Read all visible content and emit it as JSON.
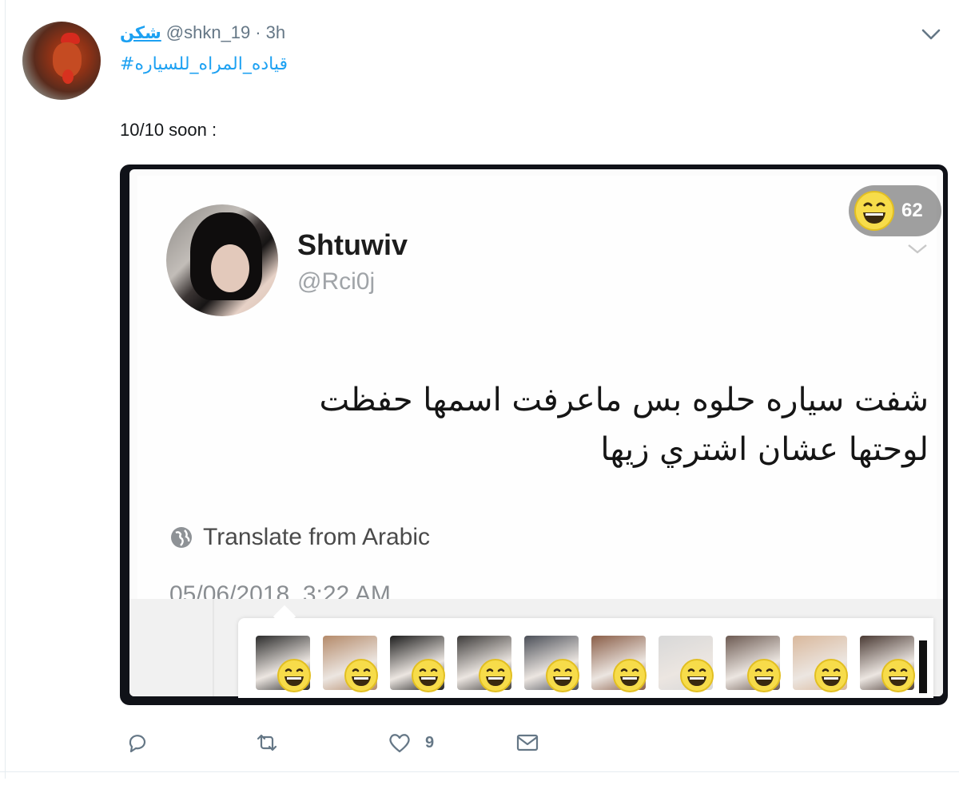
{
  "tweet": {
    "display_name": "شكن",
    "handle": "@shkn_19",
    "separator": "·",
    "time": "3h",
    "hashtag": "#قياده_المراه_للسياره",
    "text": "10/10 soon :"
  },
  "embedded_screenshot": {
    "author_name": "Shtuwiv",
    "author_handle": "@Rci0j",
    "reaction_count": "62",
    "text_line_1": "شفت سياره حلوه بس ماعرفت اسمها حفظت",
    "text_line_2": "لوحتها عشان اشتري زيها",
    "translate_label": "Translate from Arabic",
    "date": "05/06/2018, 3:22 AM",
    "reaction_faces": [
      {
        "icon": "grinning-emoji-icon",
        "bg": "#2c2c2c"
      },
      {
        "icon": "grinning-emoji-icon",
        "bg": "#b48a6a"
      },
      {
        "icon": "grinning-emoji-icon",
        "bg": "#1e1e1e"
      },
      {
        "icon": "grinning-emoji-icon",
        "bg": "#3d3b3a"
      },
      {
        "icon": "grinning-emoji-icon",
        "bg": "#4b4f58"
      },
      {
        "icon": "grinning-emoji-icon",
        "bg": "#8a5e48"
      },
      {
        "icon": "grinning-emoji-icon",
        "bg": "#d8d8d8"
      },
      {
        "icon": "grinning-emoji-icon",
        "bg": "#6c5a52"
      },
      {
        "icon": "grinning-emoji-icon",
        "bg": "#d9b89c"
      },
      {
        "icon": "grinning-emoji-icon",
        "bg": "#4a3a34"
      }
    ]
  },
  "actions": {
    "reply_icon": "reply-icon",
    "retweet_icon": "retweet-icon",
    "like_icon": "heart-icon",
    "like_count": "9",
    "dm_icon": "envelope-icon"
  },
  "colors": {
    "link": "#1da1f2",
    "muted": "#657786",
    "border": "#e6ecf0"
  }
}
